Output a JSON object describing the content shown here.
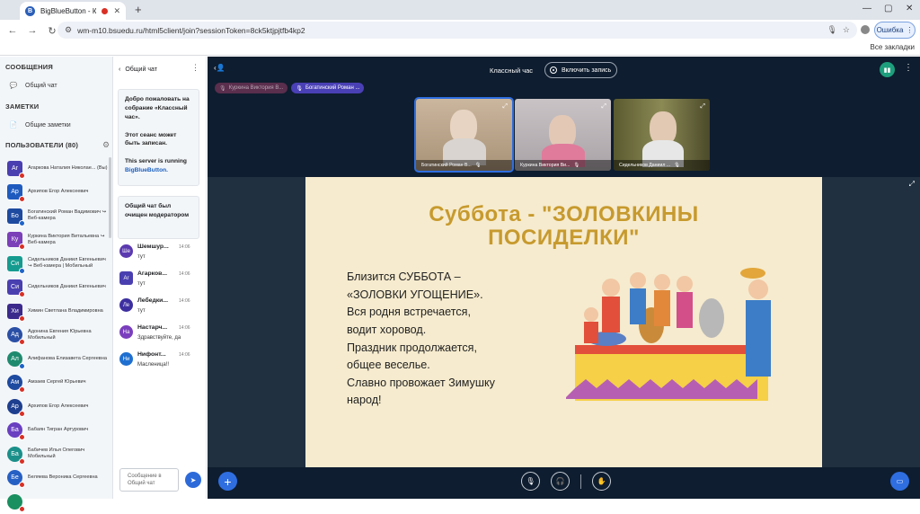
{
  "browser": {
    "tab_title": "BigBlueButton - Классный",
    "tab_favicon": "B",
    "url": "wm-m10.bsuedu.ru/html5client/join?sessionToken=8ck5ktjpjtfb4kp2",
    "error_chip": "Ошибка",
    "bookmarks_all": "Все закладки"
  },
  "left": {
    "messages_title": "СООБЩЕНИЯ",
    "public_chat": "Общий чат",
    "notes_title": "ЗАМЕТКИ",
    "shared_notes": "Общие заметки",
    "users_title": "ПОЛЬЗОВАТЕЛИ (80)",
    "users": [
      {
        "initials": "Ar",
        "name": "Агаркова Наталия Николае... (Вы)",
        "color": "#4a3fb0",
        "shape": "square",
        "dot": "red"
      },
      {
        "initials": "Ар",
        "name": "Архипов Егор Алексеевич",
        "color": "#1f5bbf",
        "shape": "square",
        "dot": "red"
      },
      {
        "initials": "Бо",
        "name": "Богатинский Роман Вадимович ↪ Веб-камера",
        "color": "#1e4aa0",
        "shape": "square",
        "dot": "blue"
      },
      {
        "initials": "Ку",
        "name": "Куркина Виктория Витальевна ↪ Веб-камера",
        "color": "#7b3fb8",
        "shape": "square",
        "dot": "red"
      },
      {
        "initials": "Си",
        "name": "Сидельников Даниил Евгеньевич ↪ Веб-камера | Мобильный",
        "color": "#159b8f",
        "shape": "square",
        "dot": "blue"
      },
      {
        "initials": "Си",
        "name": "Сидельников Даниил Евгеньевич",
        "color": "#4a3fb0",
        "shape": "square",
        "dot": "red"
      },
      {
        "initials": "Хи",
        "name": "Химин Светлана Владимировна",
        "color": "#3b2a8c",
        "shape": "square",
        "dot": "red"
      },
      {
        "initials": "Ад",
        "name": "Адонина Евгения Юрьевна Мобильный",
        "color": "#2a4fa5",
        "shape": "round",
        "dot": "red"
      },
      {
        "initials": "Ал",
        "name": "Алифанова Елизавета Сергеевна",
        "color": "#1f8a6e",
        "shape": "round",
        "dot": "blue"
      },
      {
        "initials": "Ам",
        "name": "Амзаев Сергей Юрьевич",
        "color": "#1e4aa0",
        "shape": "round",
        "dot": "red"
      },
      {
        "initials": "Ар",
        "name": "Архипов Егор Алексеевич",
        "color": "#1e3f8f",
        "shape": "round",
        "dot": "red"
      },
      {
        "initials": "Ба",
        "name": "Бабаян Тигран Артурович",
        "color": "#6a3fc0",
        "shape": "round",
        "dot": "red"
      },
      {
        "initials": "Ба",
        "name": "Бабичев Илья Олегович Мобильный",
        "color": "#1a8f8a",
        "shape": "round",
        "dot": "red"
      },
      {
        "initials": "Бе",
        "name": "Беляева Вероника Сергеевна",
        "color": "#2760c4",
        "shape": "round",
        "dot": "red"
      },
      {
        "initials": "",
        "name": "",
        "color": "#1a8f60",
        "shape": "round",
        "dot": "red"
      }
    ]
  },
  "chat": {
    "title": "Общий чат",
    "welcome_1": "Добро пожаловать на собрание «Классный час».",
    "welcome_2": "Этот сеанс может быть записан.",
    "welcome_3": "This server is running",
    "welcome_link": "BigBlueButton.",
    "cleared": "Общий чат был очищен модератором",
    "messages": [
      {
        "initials": "Ше",
        "name": "Шемшур...",
        "time": "14:06",
        "text": "тут",
        "color": "#5b3ab0",
        "shape": "round"
      },
      {
        "initials": "Ar",
        "name": "Агарков...",
        "time": "14:06",
        "text": "тут",
        "color": "#4a3fb0",
        "shape": "square"
      },
      {
        "initials": "Ле",
        "name": "Лебедки...",
        "time": "14:06",
        "text": "тут",
        "color": "#3d2fa0",
        "shape": "round"
      },
      {
        "initials": "На",
        "name": "Настарч...",
        "time": "14:06",
        "text": "Здравствуйте, да",
        "color": "#7a3fbd",
        "shape": "round"
      },
      {
        "initials": "Ни",
        "name": "Нифонт...",
        "time": "14:06",
        "text": "Масленица!!",
        "color": "#1f6fd0",
        "shape": "round"
      }
    ],
    "input_placeholder": "Сообщение в Общий чат"
  },
  "main": {
    "title": "Классный час",
    "record_label": "Включить запись",
    "talkers": [
      {
        "name": "Куркина Виктория В...",
        "state": "muted"
      },
      {
        "name": "Богатинский Роман ...",
        "state": "talking"
      }
    ],
    "videos": [
      {
        "name": "Богатинский Роман В...",
        "bg": "#c7b299"
      },
      {
        "name": "Куркина Виктория Ви...",
        "bg": "#b8b4b6"
      },
      {
        "name": "Сидельников Даниил ...",
        "bg": "#6d6a3d"
      }
    ],
    "slide": {
      "title_line1": "Суббота - \"ЗОЛОВКИНЫ",
      "title_line2": "ПОСИДЕЛКИ\"",
      "text_lines": [
        "Близится СУББОТА –",
        "«ЗОЛОВКИ УГОЩЕНИЕ».",
        "Вся родня встречается,",
        "водит хоровод.",
        "Праздник продолжается,",
        "общее веселье.",
        "Славно провожает Зимушку",
        "народ!"
      ]
    }
  }
}
